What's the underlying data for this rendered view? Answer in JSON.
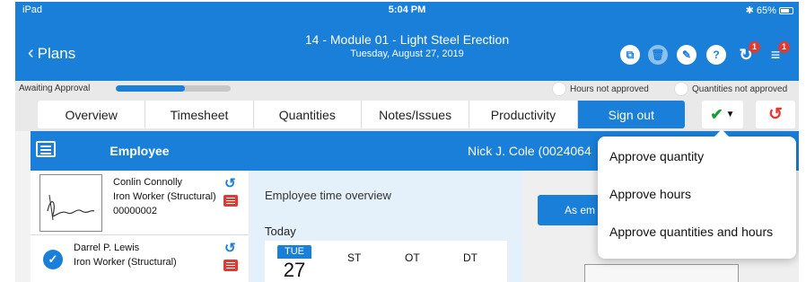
{
  "status_bar": {
    "device": "iPad",
    "time": "5:04 PM",
    "battery": "65%"
  },
  "header": {
    "back_label": "Plans",
    "title": "14 - Module 01 - Light Steel Erection",
    "subtitle": "Tuesday, August 27, 2019",
    "icons": [
      "copy-icon",
      "delete-icon",
      "edit-icon",
      "help-icon",
      "sync-icon",
      "menu-icon"
    ],
    "sync_badge": "1",
    "menu_badge": "1"
  },
  "approval": {
    "status_label": "Awaiting Approval",
    "progress_fraction": 0.6,
    "hours_label": "Hours not approved",
    "quantities_label": "Quantities not approved"
  },
  "tabs": [
    {
      "label": "Overview"
    },
    {
      "label": "Timesheet"
    },
    {
      "label": "Quantities"
    },
    {
      "label": "Notes/Issues"
    },
    {
      "label": "Productivity"
    },
    {
      "label": "Sign out"
    }
  ],
  "colors": {
    "primary": "#1a7fd8",
    "approve_green": "#1b9c3a",
    "alert_red": "#e03a32"
  },
  "employee_panel": {
    "title": "Employee",
    "employees": [
      {
        "name": "Conlin Connolly",
        "role": "Iron Worker (Structural)",
        "id": "00000002"
      },
      {
        "name": "Darrel P. Lewis",
        "role": "Iron Worker (Structural)",
        "id": ""
      }
    ]
  },
  "main": {
    "employee_heading": "Nick J. Cole (0024064",
    "overview_title": "Employee time overview",
    "today_label": "Today",
    "day_abbr": "TUE",
    "day_num": "27",
    "columns": [
      "ST",
      "OT",
      "DT"
    ],
    "as_employee_button": "As em"
  },
  "approve_menu": {
    "items": [
      "Approve quantity",
      "Approve hours",
      "Approve quantities and hours"
    ]
  }
}
